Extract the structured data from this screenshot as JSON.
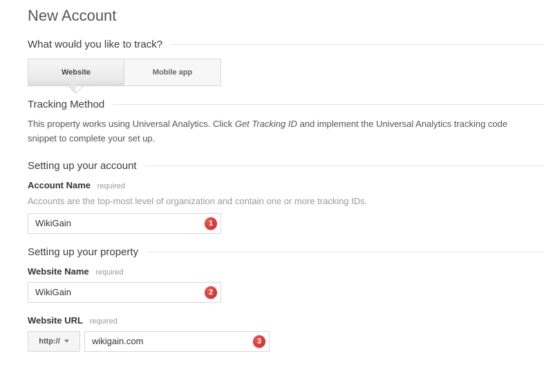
{
  "page": {
    "title": "New Account"
  },
  "track": {
    "heading": "What would you like to track?",
    "tabs": {
      "active": "Website",
      "inactive": "Mobile app"
    }
  },
  "method": {
    "heading": "Tracking Method",
    "text_before": "This property works using Universal Analytics. Click ",
    "link": "Get Tracking ID",
    "text_after": " and implement the Universal Analytics tracking code snippet to complete your set up."
  },
  "account": {
    "heading": "Setting up your account",
    "name_label": "Account Name",
    "required": "required",
    "hint": "Accounts are the top-most level of organization and contain one or more tracking IDs.",
    "name_value": "WikiGain",
    "badge1": "1"
  },
  "property": {
    "heading": "Setting up your property",
    "site_name_label": "Website Name",
    "required": "required",
    "site_name_value": "WikiGain",
    "badge2": "2",
    "url_label": "Website URL",
    "protocol": "http://",
    "url_value": "wikigain.com",
    "badge3": "3"
  }
}
